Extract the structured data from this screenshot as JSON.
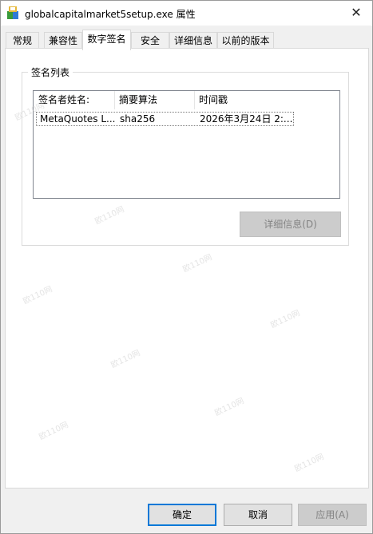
{
  "window": {
    "title": "globalcapitalmarket5setup.exe 属性"
  },
  "tabs": [
    {
      "label": "常规"
    },
    {
      "label": "兼容性"
    },
    {
      "label": "数字签名",
      "active": true
    },
    {
      "label": "安全"
    },
    {
      "label": "详细信息"
    },
    {
      "label": "以前的版本"
    }
  ],
  "signature_list": {
    "group_label": "签名列表",
    "columns": [
      "签名者姓名:",
      "摘要算法",
      "时间戳"
    ],
    "rows": [
      {
        "signer": "MetaQuotes L...",
        "digest": "sha256",
        "timestamp": "2026年3月24日 2:..."
      }
    ],
    "details_button": "详细信息(D)"
  },
  "footer": {
    "ok": "确定",
    "cancel": "取消",
    "apply": "应用(A)"
  },
  "watermark_text": "欧110网",
  "icons": {
    "app": "installer-icon",
    "close": "close-icon"
  },
  "colors": {
    "accent": "#0078d7",
    "disabled_text": "#838383"
  }
}
